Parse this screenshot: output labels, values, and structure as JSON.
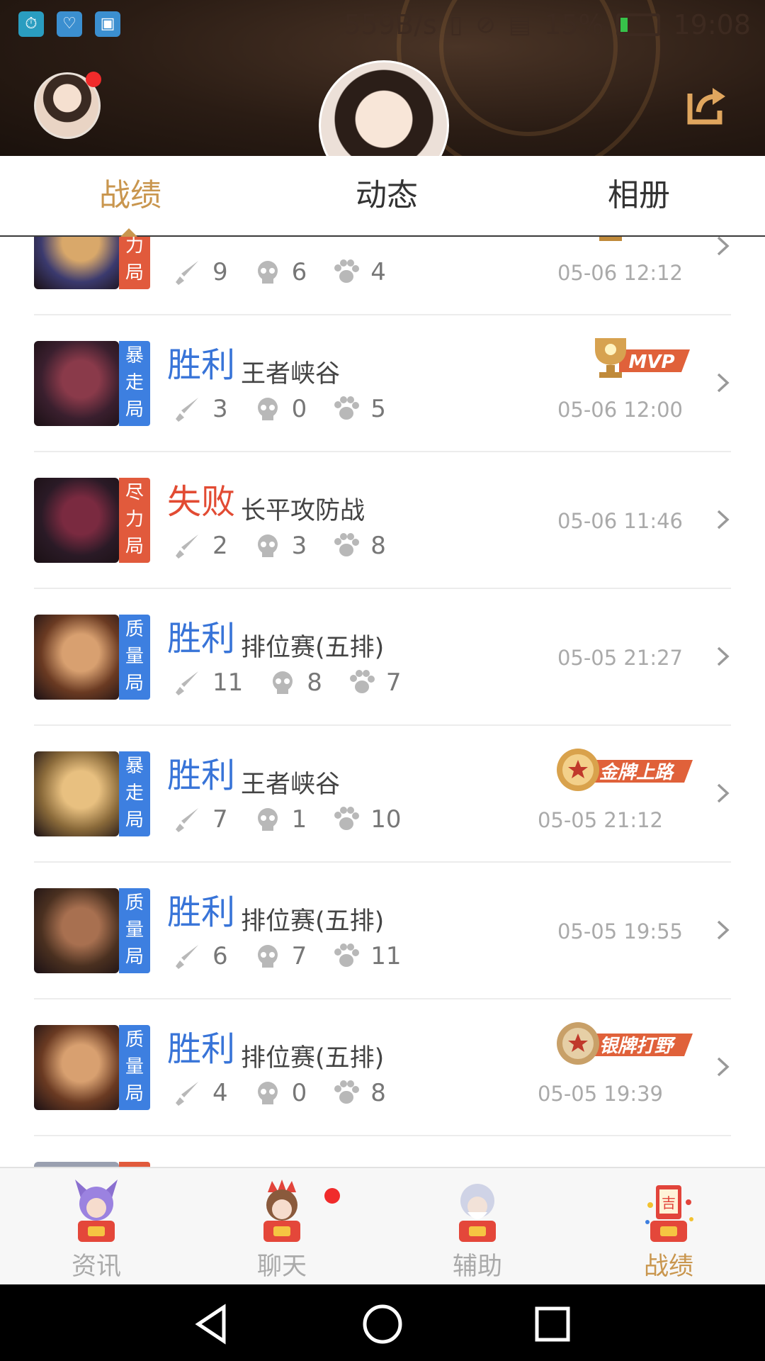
{
  "status_bar": {
    "net_speed": "559B/s",
    "battery": "15%",
    "time": "19:08"
  },
  "header": {
    "share_icon": "share-icon",
    "avatar_notification": true
  },
  "tabs": [
    {
      "label": "战绩",
      "active": true
    },
    {
      "label": "动态",
      "active": false
    },
    {
      "label": "相册",
      "active": false
    }
  ],
  "matches": [
    {
      "tag": "尽力局",
      "result": "",
      "mode": "",
      "kills": "9",
      "deaths": "6",
      "assists": "4",
      "time": "05-06 12:12",
      "badge": "MVP"
    },
    {
      "tag": "暴走局",
      "result": "胜利",
      "mode": "王者峡谷",
      "kills": "3",
      "deaths": "0",
      "assists": "5",
      "time": "05-06 12:00",
      "badge": "MVP"
    },
    {
      "tag": "尽力局",
      "result": "失败",
      "mode": "长平攻防战",
      "kills": "2",
      "deaths": "3",
      "assists": "8",
      "time": "05-06 11:46",
      "badge": ""
    },
    {
      "tag": "质量局",
      "result": "胜利",
      "mode": "排位赛(五排)",
      "kills": "11",
      "deaths": "8",
      "assists": "7",
      "time": "05-05 21:27",
      "badge": ""
    },
    {
      "tag": "暴走局",
      "result": "胜利",
      "mode": "王者峡谷",
      "kills": "7",
      "deaths": "1",
      "assists": "10",
      "time": "05-05 21:12",
      "badge": "金牌上路"
    },
    {
      "tag": "质量局",
      "result": "胜利",
      "mode": "排位赛(五排)",
      "kills": "6",
      "deaths": "7",
      "assists": "11",
      "time": "05-05 19:55",
      "badge": ""
    },
    {
      "tag": "质量局",
      "result": "胜利",
      "mode": "排位赛(五排)",
      "kills": "4",
      "deaths": "0",
      "assists": "8",
      "time": "05-05 19:39",
      "badge": "银牌打野"
    }
  ],
  "bottom_nav": [
    {
      "label": "资讯",
      "active": false
    },
    {
      "label": "聊天",
      "active": false,
      "notification": true
    },
    {
      "label": "辅助",
      "active": false
    },
    {
      "label": "战绩",
      "active": true
    }
  ],
  "colors": {
    "accent_gold": "#c9964e",
    "win_blue": "#3874d8",
    "lose_red": "#e24b33",
    "tag_blue": "#3d7fe0",
    "tag_red": "#e15a3c"
  }
}
